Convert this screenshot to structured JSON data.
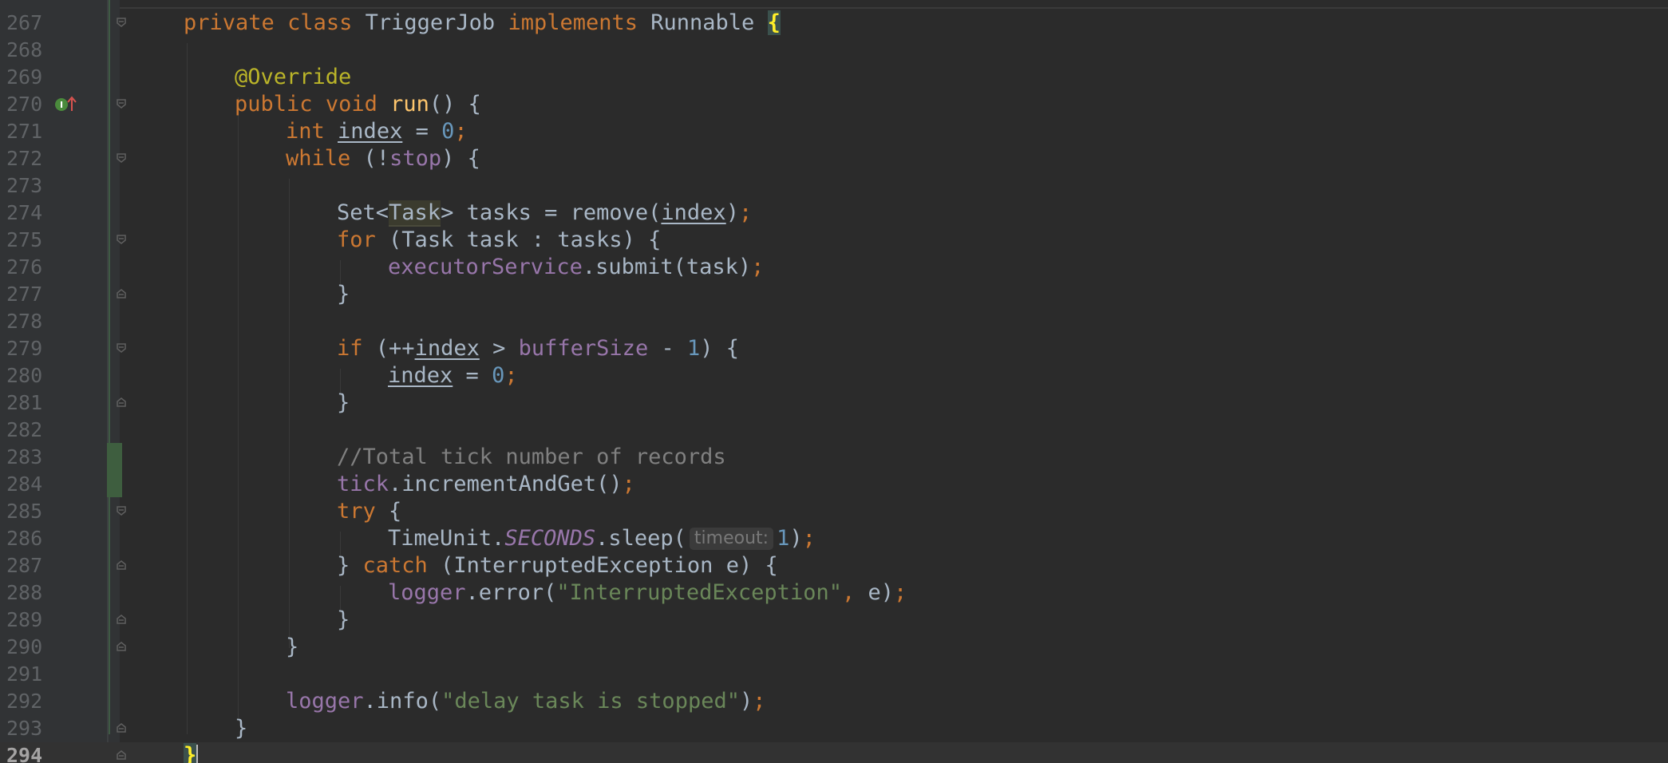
{
  "editor": {
    "language": "Java",
    "current_line": 294,
    "changed_lines": [
      283,
      284
    ],
    "colors": {
      "background": "#2b2b2b",
      "keyword": "#cc7832",
      "annotation": "#bbb529",
      "method_decl": "#ffc66d",
      "number": "#6897bb",
      "field": "#9876aa",
      "string": "#6a8759",
      "comment": "#808080",
      "text": "#a9b7c6"
    },
    "lines": [
      {
        "n": "267"
      },
      {
        "n": "268"
      },
      {
        "n": "269"
      },
      {
        "n": "270"
      },
      {
        "n": "271"
      },
      {
        "n": "272"
      },
      {
        "n": "273"
      },
      {
        "n": "274"
      },
      {
        "n": "275"
      },
      {
        "n": "276"
      },
      {
        "n": "277"
      },
      {
        "n": "278"
      },
      {
        "n": "279"
      },
      {
        "n": "280"
      },
      {
        "n": "281"
      },
      {
        "n": "282"
      },
      {
        "n": "283"
      },
      {
        "n": "284"
      },
      {
        "n": "285"
      },
      {
        "n": "286"
      },
      {
        "n": "287"
      },
      {
        "n": "288"
      },
      {
        "n": "289"
      },
      {
        "n": "290"
      },
      {
        "n": "291"
      },
      {
        "n": "292"
      },
      {
        "n": "293"
      },
      {
        "n": "294"
      }
    ],
    "tokens": {
      "l267": [
        "private",
        "class",
        "TriggerJob",
        "implements",
        "Runnable",
        "{"
      ],
      "l269": [
        "@Override"
      ],
      "l270": [
        "public",
        "void",
        "run",
        "()",
        "{"
      ],
      "l271": [
        "int",
        "index",
        "=",
        "0",
        ";"
      ],
      "l272": [
        "while",
        "(!",
        "stop",
        ")",
        "{"
      ],
      "l274": [
        "Set<",
        "Task",
        "> tasks = remove(",
        "index",
        ")",
        ";"
      ],
      "l275": [
        "for",
        "(Task task : tasks) {"
      ],
      "l276": [
        "executorService",
        ".submit(task)",
        ";"
      ],
      "l277": [
        "}"
      ],
      "l279": [
        "if",
        "(++",
        "index",
        ">",
        "bufferSize",
        "-",
        "1",
        ") {"
      ],
      "l280": [
        "index",
        "=",
        "0",
        ";"
      ],
      "l281": [
        "}"
      ],
      "l283": [
        "//Total tick number of records"
      ],
      "l284": [
        "tick",
        ".incrementAndGet()",
        ";"
      ],
      "l285": [
        "try",
        "{"
      ],
      "l286": [
        "TimeUnit.",
        "SECONDS",
        ".sleep(",
        "timeout:",
        "1",
        ")",
        ";"
      ],
      "l287": [
        "}",
        "catch",
        "(InterruptedException e) {"
      ],
      "l288": [
        "logger",
        ".error(",
        "\"InterruptedException\"",
        ",",
        "e)",
        ";"
      ],
      "l289": [
        "}"
      ],
      "l290": [
        "}"
      ],
      "l292": [
        "logger",
        ".info(",
        "\"delay task is stopped\"",
        ")",
        ";"
      ],
      "l293": [
        "}"
      ],
      "l294": [
        "}"
      ]
    },
    "gutter_icons": {
      "l270": "implements-method-icon"
    }
  }
}
